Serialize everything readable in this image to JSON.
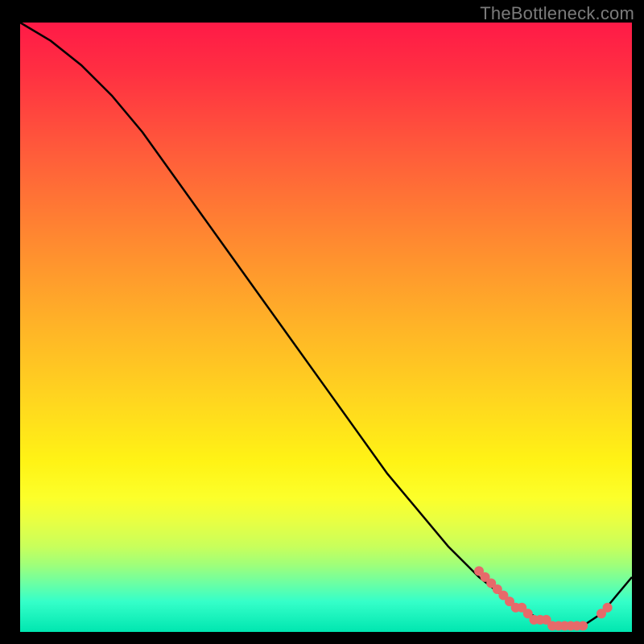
{
  "watermark": "TheBottleneck.com",
  "chart_data": {
    "type": "line",
    "title": "",
    "xlabel": "",
    "ylabel": "",
    "xlim": [
      0,
      100
    ],
    "ylim": [
      0,
      100
    ],
    "grid": false,
    "legend": false,
    "gradient_stops": [
      {
        "pct": 0,
        "color": "#ff1a47"
      },
      {
        "pct": 22,
        "color": "#ff5e3a"
      },
      {
        "pct": 50,
        "color": "#ffb427"
      },
      {
        "pct": 72,
        "color": "#fff315"
      },
      {
        "pct": 86,
        "color": "#c8ff5b"
      },
      {
        "pct": 95,
        "color": "#35ffc9"
      },
      {
        "pct": 100,
        "color": "#00e6b0"
      }
    ],
    "series": [
      {
        "name": "bottleneck-curve",
        "color": "#000000",
        "x": [
          0,
          5,
          10,
          15,
          20,
          25,
          30,
          35,
          40,
          45,
          50,
          55,
          60,
          65,
          70,
          75,
          80,
          85,
          88,
          90,
          92,
          95,
          100
        ],
        "values": [
          100,
          97,
          93,
          88,
          82,
          75,
          68,
          61,
          54,
          47,
          40,
          33,
          26,
          20,
          14,
          9,
          5,
          2,
          1,
          1,
          1,
          3,
          9
        ]
      }
    ],
    "dot_band": {
      "name": "highlight-dots",
      "color": "#e66a6a",
      "radius": 6,
      "points": [
        {
          "x": 75,
          "y": 10
        },
        {
          "x": 76,
          "y": 9
        },
        {
          "x": 77,
          "y": 8
        },
        {
          "x": 78,
          "y": 7
        },
        {
          "x": 79,
          "y": 6
        },
        {
          "x": 80,
          "y": 5
        },
        {
          "x": 81,
          "y": 4
        },
        {
          "x": 82,
          "y": 4
        },
        {
          "x": 83,
          "y": 3
        },
        {
          "x": 84,
          "y": 2
        },
        {
          "x": 85,
          "y": 2
        },
        {
          "x": 86,
          "y": 2
        },
        {
          "x": 87,
          "y": 1
        },
        {
          "x": 88,
          "y": 1
        },
        {
          "x": 89,
          "y": 1
        },
        {
          "x": 90,
          "y": 1
        },
        {
          "x": 91,
          "y": 1
        },
        {
          "x": 92,
          "y": 1
        },
        {
          "x": 95,
          "y": 3
        },
        {
          "x": 96,
          "y": 4
        }
      ]
    }
  }
}
